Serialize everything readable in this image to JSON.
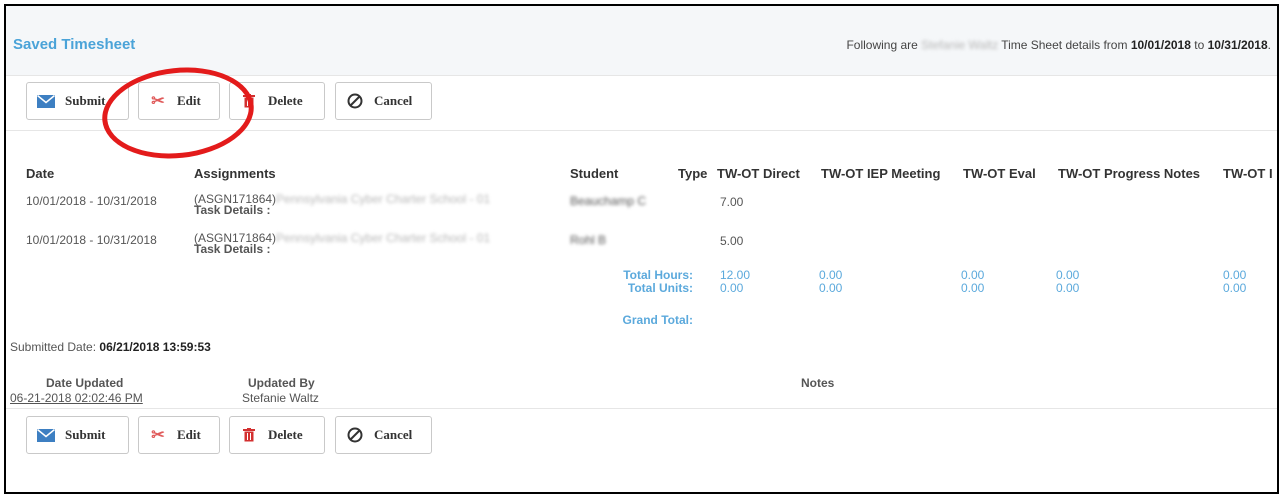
{
  "header": {
    "title": "Saved Timesheet",
    "info_prefix": "Following are",
    "employee_name_blurred": "Stefanie Waltz",
    "info_middle": "Time Sheet details from",
    "date_from": "10/01/2018",
    "info_to": "to",
    "date_to": "10/31/2018",
    "info_end": "."
  },
  "toolbar": {
    "submit": "Submit",
    "edit": "Edit",
    "delete": "Delete",
    "cancel": "Cancel"
  },
  "table": {
    "columns": [
      "Date",
      "Assignments",
      "Student",
      "Type",
      "TW-OT Direct",
      "TW-OT IEP Meeting",
      "TW-OT Eval",
      "TW-OT Progress Notes",
      "TW-OT I"
    ],
    "rows": [
      {
        "date": "10/01/2018 - 10/31/2018",
        "assignment_id": "(ASGN171864)",
        "assignment_blurred": "Pennsylvania Cyber Charter School - 01",
        "task_label": "Task Details :",
        "student_blurred": "Beauchamp C",
        "direct": "7.00"
      },
      {
        "date": "10/01/2018 - 10/31/2018",
        "assignment_id": "(ASGN171864)",
        "assignment_blurred": "Pennsylvania Cyber Charter School - 01",
        "task_label": "Task Details :",
        "student_blurred": "Rohl B",
        "direct": "5.00"
      }
    ],
    "totals": {
      "hours_label": "Total Hours:",
      "units_label": "Total Units:",
      "grand_label": "Grand Total:",
      "hours": [
        "12.00",
        "0.00",
        "0.00",
        "0.00",
        "0.00"
      ],
      "units": [
        "0.00",
        "0.00",
        "0.00",
        "0.00",
        "0.00"
      ]
    }
  },
  "submitted": {
    "label": "Submitted Date:",
    "value": "06/21/2018 13:59:53"
  },
  "updates": {
    "col_date": "Date Updated",
    "col_by": "Updated By",
    "col_notes": "Notes",
    "date_value": "06-21-2018 02:02:46 PM",
    "by_value": "Stefanie Waltz"
  },
  "colors": {
    "accent": "#4aa3d8",
    "totals": "#5ba9dc",
    "annotation": "#e31b1b"
  }
}
